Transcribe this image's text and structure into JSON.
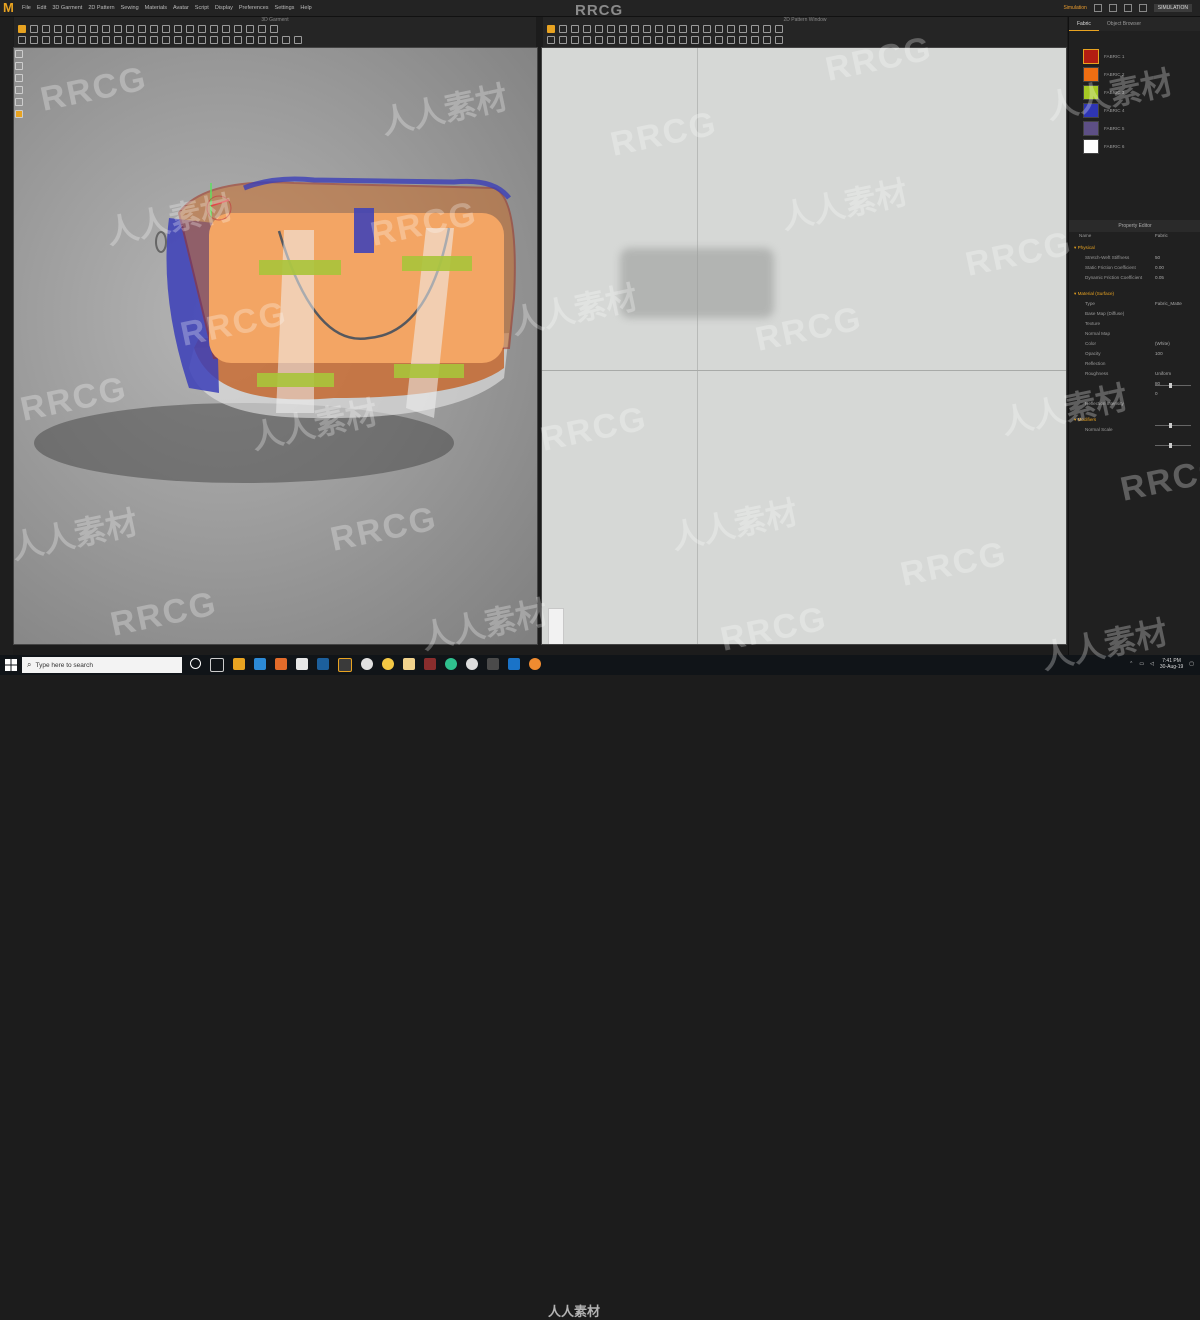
{
  "app": {
    "brand": "RRCG",
    "menus": [
      "File",
      "Edit",
      "3D Garment",
      "2D Pattern",
      "Sewing",
      "Materials",
      "Avatar",
      "Script",
      "Display",
      "Preferences",
      "Settings",
      "Help"
    ],
    "status_user": "Simulation",
    "sim_badge": "SIMULATION"
  },
  "views": {
    "left_title": "3D Garment",
    "right_title": "2D Pattern Window"
  },
  "right_panel": {
    "tabs": [
      "Fabric",
      "Object Browser"
    ],
    "fabrics": [
      {
        "name": "FABRIC 1",
        "color": "#b21e12"
      },
      {
        "name": "FABRIC 2",
        "color": "#ee6e12"
      },
      {
        "name": "FABRIC 3",
        "color": "#a5c824"
      },
      {
        "name": "FABRIC 4",
        "color": "#2e35b4"
      },
      {
        "name": "FABRIC 5",
        "color": "#5d4f85"
      },
      {
        "name": "FABRIC 6",
        "color": "#ffffff"
      }
    ],
    "property_editor": {
      "title": "Property Editor",
      "name_label": "Name",
      "name_value": "Fabric",
      "sections": [
        {
          "label": "Physical",
          "rows": [
            {
              "label": "Stretch-Weft Stiffness",
              "value": "50"
            },
            {
              "label": "Static Friction Coefficient",
              "value": "0.00"
            },
            {
              "label": "Dynamic Friction Coefficient",
              "value": "0.05"
            }
          ]
        },
        {
          "label": "Material (Surface)",
          "rows": [
            {
              "label": "Type",
              "value": "Fabric_Matte"
            },
            {
              "label": "Base Map (Diffuse)",
              "value": ""
            },
            {
              "label": "Texture",
              "value": ""
            },
            {
              "label": "Normal Map",
              "value": ""
            },
            {
              "label": "Color",
              "value": "(White)"
            },
            {
              "label": "Opacity",
              "value": "100"
            },
            {
              "label": "Reflection",
              "value": ""
            },
            {
              "label": "Roughness",
              "value": "Uniform"
            },
            {
              "label": "",
              "value": "80"
            },
            {
              "label": "",
              "value": "0"
            },
            {
              "label": "Reflection Intensity",
              "value": ""
            }
          ]
        },
        {
          "label": "Modifiers",
          "rows": [
            {
              "label": "Normal Scale",
              "value": ""
            }
          ]
        }
      ]
    }
  },
  "taskbar": {
    "search_placeholder": "Type here to search",
    "watermark": "人人素材",
    "time": "7:41 PM",
    "date": "30-Aug-19"
  },
  "watermarks": {
    "rrcg": "RRCG",
    "cn": "人人素材"
  },
  "colors": {
    "accent": "#e8a321",
    "bag_orange": "#f3a05e",
    "bag_green": "#a9c43a",
    "bag_blue": "#3c3fb5",
    "pattern_bg": "#d6d8d6"
  }
}
